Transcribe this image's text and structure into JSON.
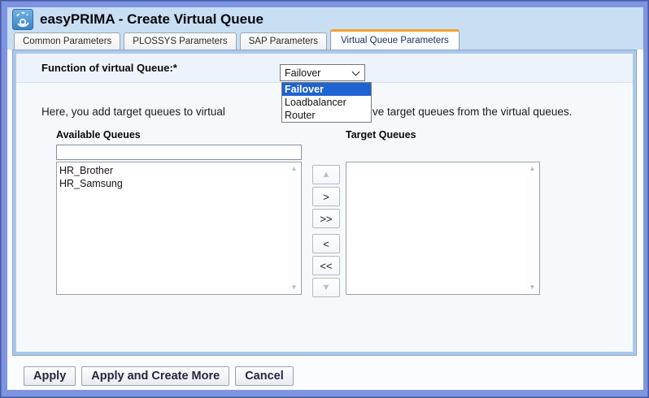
{
  "window": {
    "title": "easyPRIMA - Create Virtual Queue"
  },
  "tabs": [
    {
      "label": "Common Parameters",
      "active": false
    },
    {
      "label": "PLOSSYS Parameters",
      "active": false
    },
    {
      "label": "SAP Parameters",
      "active": false
    },
    {
      "label": "Virtual Queue Parameters",
      "active": true
    }
  ],
  "form": {
    "function_label": "Function of virtual Queue:*",
    "function_select": {
      "value": "Failover",
      "options": [
        "Failover",
        "Loadbalancer",
        "Router"
      ],
      "highlighted_option": "Failover"
    },
    "description_before": "Here, you add target queues to virtual",
    "description_after": "ve target queues from the virtual queues.",
    "available": {
      "label": "Available Queues",
      "filter_value": "",
      "items": [
        "HR_Brother",
        "HR_Samsung"
      ]
    },
    "target": {
      "label": "Target Queues",
      "items": []
    },
    "transfer": {
      "up": "▲",
      "right": ">",
      "all_right": ">>",
      "left": "<",
      "all_left": "<<",
      "down": "▼"
    }
  },
  "footer": {
    "buttons": [
      "Apply",
      "Apply and Create More",
      "Cancel"
    ]
  },
  "colors": {
    "accent_orange": "#f0a22e",
    "selection_blue": "#1e63d2",
    "frame_blue": "#7d95e1",
    "header_blue": "#c8def3"
  }
}
